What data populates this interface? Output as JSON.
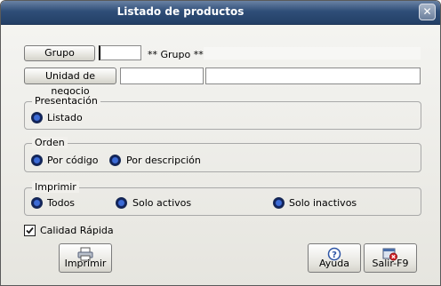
{
  "window": {
    "title": "Listado de productos",
    "close_glyph": "✕"
  },
  "grupo": {
    "button_label": "Grupo",
    "code_value": "",
    "description": "** Grupo **"
  },
  "unidad": {
    "button_label": "Unidad de negocio",
    "code_value": "",
    "description": ""
  },
  "presentacion": {
    "legend": "Presentación",
    "options": [
      "Listado"
    ],
    "selected": "Listado"
  },
  "orden": {
    "legend": "Orden",
    "options": [
      "Por código",
      "Por descripción"
    ],
    "selected": "Por descripción"
  },
  "imprimir": {
    "legend": "Imprimir",
    "options": [
      "Todos",
      "Solo activos",
      "Solo inactivos"
    ],
    "selected": "Solo inactivos"
  },
  "calidad": {
    "label": "Calidad Rápida",
    "checked": true
  },
  "buttons": {
    "print": {
      "label": "Imprimir",
      "icon": "printer-icon"
    },
    "help": {
      "label": "Ayuda",
      "icon": "help-icon"
    },
    "exit": {
      "label": "Salir-F9",
      "icon": "exit-icon"
    }
  },
  "colors": {
    "titlebar": "#2f4e78",
    "radio": "#11235a",
    "exit_accent": "#d8262b"
  }
}
